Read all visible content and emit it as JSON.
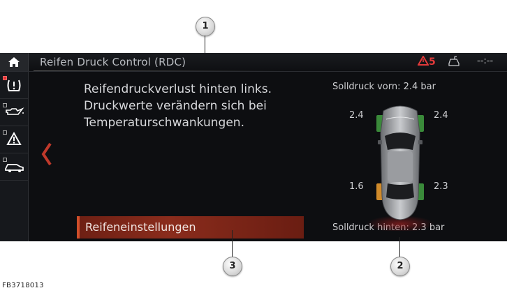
{
  "header": {
    "title": "Reifen Druck Control (RDC)",
    "warning_count": "5",
    "clock": "--:--"
  },
  "sidebar": {
    "items": [
      {
        "icon": "tire-pressure-warning-icon"
      },
      {
        "icon": "oil-can-icon"
      },
      {
        "icon": "warning-triangle-icon"
      },
      {
        "icon": "car-icon"
      }
    ]
  },
  "message": {
    "lines": [
      "Reifendruckverlust hinten links.",
      "Druckwerte verändern sich bei",
      "Temperaturschwankungen."
    ]
  },
  "settings_button": {
    "label": "Reifeneinstellungen"
  },
  "car": {
    "setpoint_front": "Solldruck vorn: 2.4 bar",
    "setpoint_rear": "Solldruck hinten: 2.3 bar",
    "pressures": {
      "front_left": "2.4",
      "front_right": "2.4",
      "rear_left": "1.6",
      "rear_right": "2.3"
    },
    "colors": {
      "ok": "#3a8a3a",
      "warning": "#d08a2a"
    }
  },
  "callouts": [
    "1",
    "2",
    "3"
  ],
  "figure_code": "FB3718013"
}
